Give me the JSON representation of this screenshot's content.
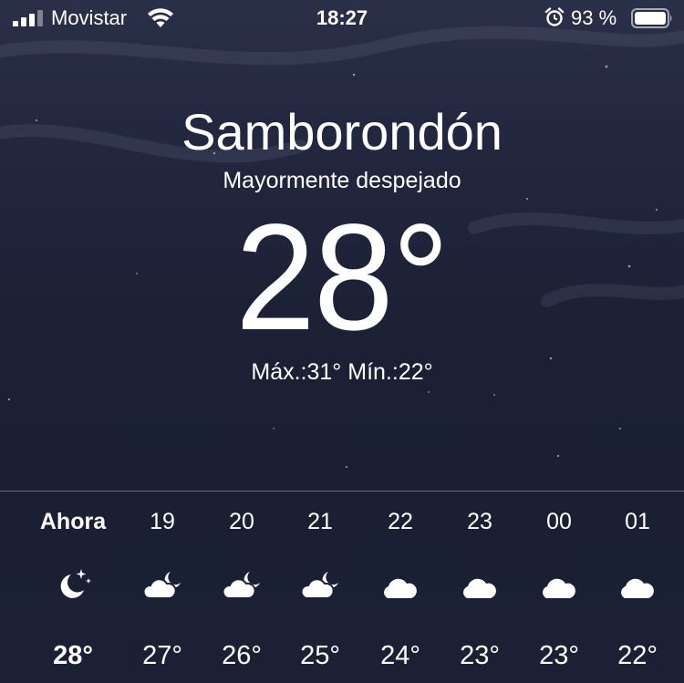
{
  "status_bar": {
    "carrier": "Movistar",
    "time": "18:27",
    "battery_percent": "93 %",
    "icons": [
      "signal-icon",
      "wifi-icon",
      "alarm-icon",
      "battery-icon"
    ]
  },
  "location": {
    "city": "Samborondón",
    "condition": "Mayormente despejado",
    "temperature": "28°",
    "high_low": "Máx.:31° Mín.:22°"
  },
  "hourly": [
    {
      "label": "Ahora",
      "icon": "moon-stars-icon",
      "temp": "28°"
    },
    {
      "label": "19",
      "icon": "cloud-moon-icon",
      "temp": "27°"
    },
    {
      "label": "20",
      "icon": "cloud-moon-icon",
      "temp": "26°"
    },
    {
      "label": "21",
      "icon": "cloud-moon-icon",
      "temp": "25°"
    },
    {
      "label": "22",
      "icon": "cloud-icon",
      "temp": "24°"
    },
    {
      "label": "23",
      "icon": "cloud-icon",
      "temp": "23°"
    },
    {
      "label": "00",
      "icon": "cloud-icon",
      "temp": "23°"
    },
    {
      "label": "01",
      "icon": "cloud-icon",
      "temp": "22°"
    }
  ],
  "colors": {
    "background_top": "#2a3048",
    "background_bottom": "#1b2034",
    "text": "#ffffff"
  }
}
